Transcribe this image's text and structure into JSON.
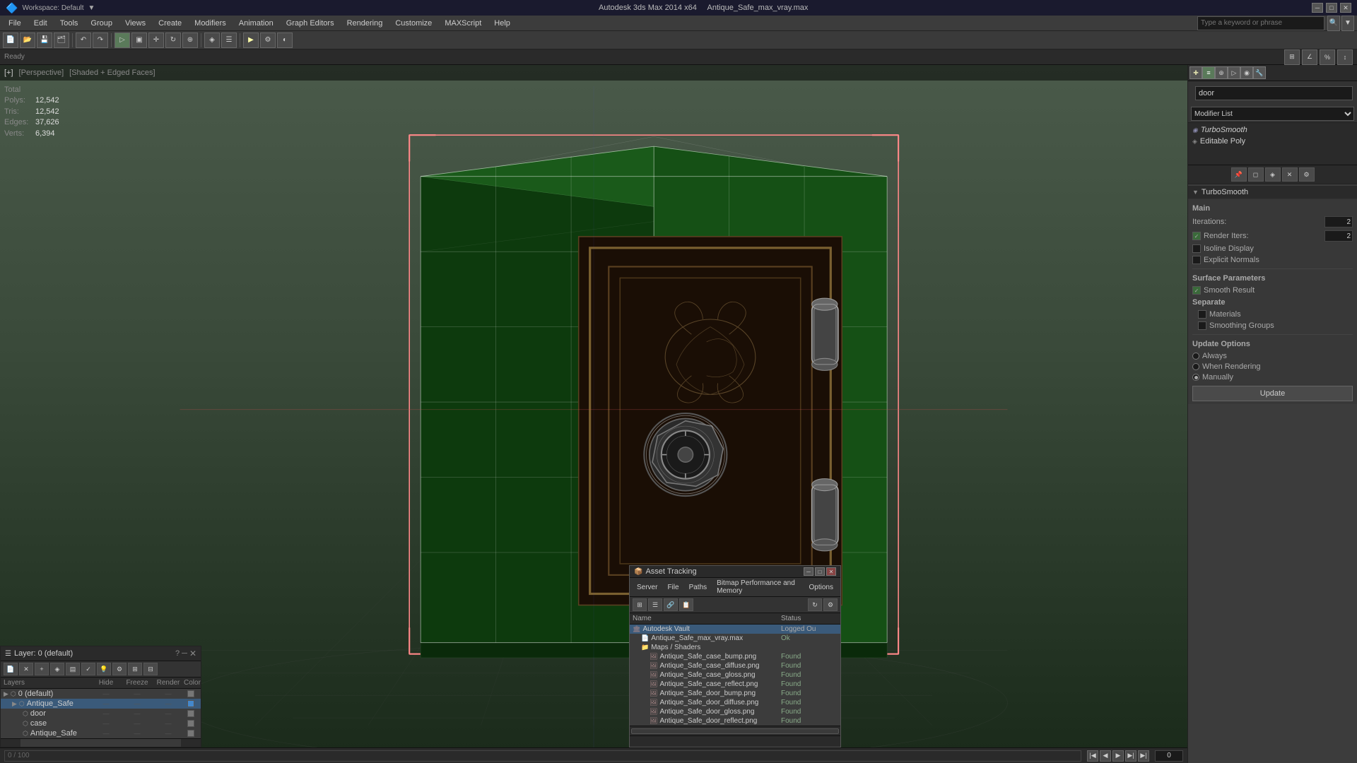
{
  "titleBar": {
    "appName": "Autodesk 3ds Max 2014 x64",
    "fileName": "Antique_Safe_max_vray.max",
    "minimizeLabel": "─",
    "maximizeLabel": "□",
    "closeLabel": "✕",
    "workspaceLabel": "Workspace: Default"
  },
  "menuBar": {
    "items": [
      {
        "label": "File",
        "id": "file"
      },
      {
        "label": "Edit",
        "id": "edit"
      },
      {
        "label": "Tools",
        "id": "tools"
      },
      {
        "label": "Group",
        "id": "group"
      },
      {
        "label": "Views",
        "id": "views"
      },
      {
        "label": "Create",
        "id": "create"
      },
      {
        "label": "Modifiers",
        "id": "modifiers"
      },
      {
        "label": "Animation",
        "id": "animation"
      },
      {
        "label": "Graph Editors",
        "id": "graph-editors"
      },
      {
        "label": "Rendering",
        "id": "rendering"
      },
      {
        "label": "Customize",
        "id": "customize"
      },
      {
        "label": "MAXScript",
        "id": "maxscript"
      },
      {
        "label": "Help",
        "id": "help"
      }
    ]
  },
  "viewport": {
    "label": "+",
    "perspective": "Perspective",
    "shading": "Shaded + Edged Faces",
    "stats": {
      "polysLabel": "Polys:",
      "polysValue": "12,542",
      "trisLabel": "Tris:",
      "trisValue": "12,542",
      "edgesLabel": "Edges:",
      "edgesValue": "37,626",
      "vertsLabel": "Verts:",
      "vertsValue": "6,394",
      "totalLabel": "Total"
    }
  },
  "commandPanel": {
    "nameInput": "door",
    "modifierListLabel": "Modifier List",
    "modifiers": [
      {
        "label": "TurboSmooth",
        "selected": false,
        "italic": true
      },
      {
        "label": "Editable Poly",
        "selected": false
      }
    ],
    "sections": {
      "turboSmooth": {
        "title": "TurboSmooth",
        "main": "Main",
        "iterationsLabel": "Iterations:",
        "iterationsValue": "2",
        "renderItersLabel": "Render Iters:",
        "renderItersValue": "2",
        "renderItersChecked": true,
        "isolineDisplay": "Isoline Display",
        "isolineChecked": false,
        "explicitNormals": "Explicit Normals",
        "explicitChecked": false,
        "surfaceParams": "Surface Parameters",
        "smoothResult": "Smooth Result",
        "smoothChecked": true,
        "separate": "Separate",
        "materials": "Materials",
        "materialsChecked": false,
        "smoothingGroups": "Smoothing Groups",
        "smoothingGroupsChecked": false,
        "updateOptions": "Update Options",
        "always": "Always",
        "whenRendering": "When Rendering",
        "manually": "Manually",
        "updateLabel": "Update"
      }
    }
  },
  "layersPanel": {
    "title": "Layer: 0 (default)",
    "questionMark": "?",
    "closeBtn": "✕",
    "columns": {
      "layers": "Layers",
      "hide": "Hide",
      "freeze": "Freeze",
      "render": "Render",
      "color": "Color"
    },
    "layers": [
      {
        "name": "0 (default)",
        "indent": 0,
        "selected": false,
        "hide": "",
        "freeze": "",
        "render": "",
        "color": "gray"
      },
      {
        "name": "Antique_Safe",
        "indent": 1,
        "selected": true,
        "hide": "",
        "freeze": "",
        "render": "",
        "color": "blue"
      },
      {
        "name": "door",
        "indent": 2,
        "selected": false,
        "hide": "",
        "freeze": "",
        "render": "",
        "color": "gray"
      },
      {
        "name": "case",
        "indent": 2,
        "selected": false,
        "hide": "",
        "freeze": "",
        "render": "",
        "color": "gray"
      },
      {
        "name": "Antique_Safe",
        "indent": 2,
        "selected": false,
        "hide": "",
        "freeze": "",
        "render": "",
        "color": "gray"
      }
    ]
  },
  "assetPanel": {
    "title": "Asset Tracking",
    "minBtn": "─",
    "maxBtn": "□",
    "closeBtn": "✕",
    "menuItems": [
      "Server",
      "File",
      "Paths",
      "Bitmap Performance and Memory",
      "Options"
    ],
    "columns": {
      "name": "Name",
      "status": "Status"
    },
    "assets": [
      {
        "name": "Autodesk Vault",
        "indent": 0,
        "status": "Logged Ou",
        "icon": "vault"
      },
      {
        "name": "Antique_Safe_max_vray.max",
        "indent": 1,
        "status": "Ok",
        "icon": "file"
      },
      {
        "name": "Maps / Shaders",
        "indent": 1,
        "status": "",
        "icon": "folder"
      },
      {
        "name": "Antique_Safe_case_bump.png",
        "indent": 2,
        "status": "Found",
        "icon": "image"
      },
      {
        "name": "Antique_Safe_case_diffuse.png",
        "indent": 2,
        "status": "Found",
        "icon": "image"
      },
      {
        "name": "Antique_Safe_case_gloss.png",
        "indent": 2,
        "status": "Found",
        "icon": "image"
      },
      {
        "name": "Antique_Safe_case_reflect.png",
        "indent": 2,
        "status": "Found",
        "icon": "image"
      },
      {
        "name": "Antique_Safe_door_bump.png",
        "indent": 2,
        "status": "Found",
        "icon": "image"
      },
      {
        "name": "Antique_Safe_door_diffuse.png",
        "indent": 2,
        "status": "Found",
        "icon": "image"
      },
      {
        "name": "Antique_Safe_door_gloss.png",
        "indent": 2,
        "status": "Found",
        "icon": "image"
      },
      {
        "name": "Antique_Safe_door_reflect.png",
        "indent": 2,
        "status": "Found",
        "icon": "image"
      }
    ]
  },
  "searchBox": {
    "placeholder": "Type a keyword or phrase"
  }
}
